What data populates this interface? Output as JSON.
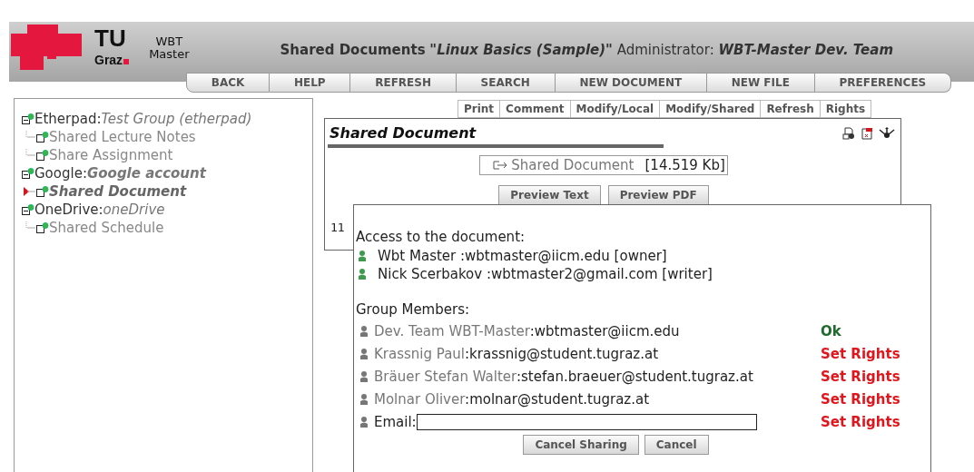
{
  "logo": {
    "line_1": "TU",
    "line_2": "Graz",
    "product_1": "WBT",
    "product_2": "Master"
  },
  "header": {
    "prefix": "Shared Documents",
    "course": "\"Linux Basics (Sample)\"",
    "role": "Administrator:",
    "user": "WBT-Master Dev. Team"
  },
  "nav": [
    "BACK",
    "HELP",
    "REFRESH",
    "SEARCH",
    "NEW DOCUMENT",
    "NEW FILE",
    "PREFERENCES"
  ],
  "tree": [
    {
      "service": "Etherpad:",
      "account": "Test Group (etherpad)",
      "kind": "italic",
      "children": [
        {
          "label": "Shared Lecture Notes",
          "selected": false
        },
        {
          "label": "Share Assignment",
          "selected": false
        }
      ]
    },
    {
      "service": "Google:",
      "account": "Google account",
      "kind": "bold-italic",
      "children": [
        {
          "label": "Shared Document",
          "selected": true
        }
      ]
    },
    {
      "service": "OneDrive:",
      "account": "oneDrive",
      "kind": "italic",
      "children": [
        {
          "label": "Shared Schedule",
          "selected": false
        }
      ]
    }
  ],
  "doc_tabs": [
    "Print",
    "Comment",
    "Modify/Local",
    "Modify/Shared",
    "Refresh",
    "Rights"
  ],
  "document": {
    "title": "Shared Document",
    "file": "Shared Document",
    "size": "[14.519 Kb]",
    "preview_buttons": [
      "Preview Text",
      "Preview PDF"
    ],
    "line_number": "11"
  },
  "sharing": {
    "access_heading": "Access to the document:",
    "access": [
      {
        "name": "Wbt Master",
        "email": ":wbtmaster@iicm.edu [owner]"
      },
      {
        "name": "Nick Scerbakov",
        "email": ":wbtmaster2@gmail.com [writer]"
      }
    ],
    "members_heading": "Group Members:",
    "members": [
      {
        "name": "Dev. Team WBT-Master",
        "email": ":wbtmaster@iicm.edu",
        "status": "Ok",
        "color": "#1e6b2c"
      },
      {
        "name": "Krassnig Paul",
        "email": ":krassnig@student.tugraz.at",
        "status": "Set Rights",
        "color": "#e0161d"
      },
      {
        "name": "Bräuer Stefan Walter",
        "email": ":stefan.braeuer@student.tugraz.at",
        "status": "Set Rights",
        "color": "#e0161d"
      },
      {
        "name": "Molnar Oliver",
        "email": ":molnar@student.tugraz.at",
        "status": "Set Rights",
        "color": "#e0161d"
      }
    ],
    "email_row": {
      "label": "Email:",
      "status": "Set Rights",
      "color": "#e0161d"
    },
    "buttons": [
      "Cancel Sharing",
      "Cancel"
    ]
  }
}
